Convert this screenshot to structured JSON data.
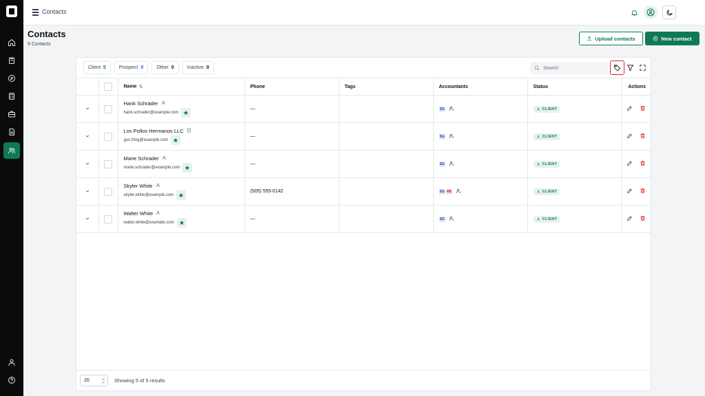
{
  "app": {
    "topbar_title": "Contacts"
  },
  "header": {
    "title": "Contacts",
    "subtitle": "5 Contacts",
    "upload_label": "Upload contacts",
    "new_label": "New contact"
  },
  "filters": [
    {
      "label": "Client",
      "count": "5"
    },
    {
      "label": "Prospect",
      "count": "0"
    },
    {
      "label": "Other",
      "count": "0"
    },
    {
      "label": "Inactive",
      "count": "0"
    }
  ],
  "search": {
    "placeholder": "Search"
  },
  "table": {
    "headers": {
      "name": "Name",
      "phone": "Phone",
      "tags": "Tags",
      "accountants": "Accountants",
      "status": "Status",
      "actions": "Actions"
    },
    "rows": [
      {
        "name": "Hank Schrader",
        "type_icon": "person-icon",
        "email": "hank.schrader@example.com",
        "phone": "—",
        "tags": "",
        "accountants": [
          "SG"
        ],
        "status": "CLIENT"
      },
      {
        "name": "Los Pollos Hermanos LLC",
        "type_icon": "building-icon",
        "email": "gus.fring@example.com",
        "phone": "—",
        "tags": "",
        "accountants": [
          "SG"
        ],
        "status": "CLIENT"
      },
      {
        "name": "Marie Schrader",
        "type_icon": "person-icon",
        "email": "marie.schrader@example.com",
        "phone": "—",
        "tags": "",
        "accountants": [
          "SG"
        ],
        "status": "CLIENT"
      },
      {
        "name": "Skyler White",
        "type_icon": "person-icon",
        "email": "skyler.white@example.com",
        "phone": "(505) 555-0142",
        "tags": "",
        "accountants": [
          "SG",
          "ME"
        ],
        "status": "CLIENT"
      },
      {
        "name": "Walter White",
        "type_icon": "person-icon",
        "email": "walter.white@example.com",
        "phone": "—",
        "tags": "",
        "accountants": [
          "SG"
        ],
        "status": "CLIENT"
      }
    ]
  },
  "footer": {
    "page_size": "20",
    "showing": "Showing 5 of 5 results"
  },
  "colors": {
    "brand": "#0f7a55",
    "danger": "#dc2626",
    "sidebar": "#0b0b0b"
  }
}
